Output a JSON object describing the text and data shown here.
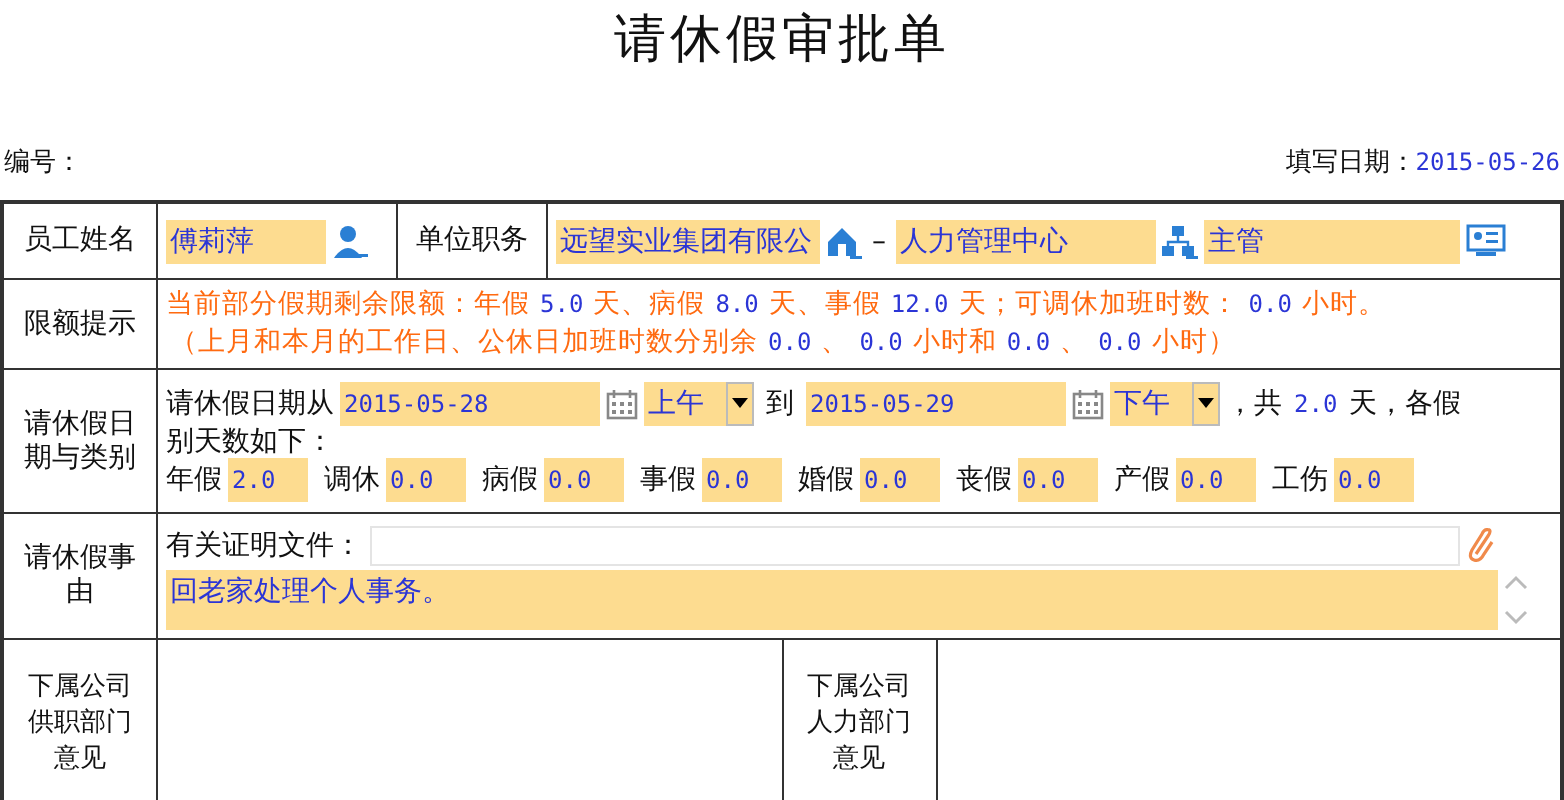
{
  "title": "请休假审批单",
  "header": {
    "number_label": "编号：",
    "date_label": "填写日期：",
    "date": "2015-05-26"
  },
  "employee": {
    "label": "员工姓名",
    "name": "傅莉萍",
    "position_label": "单位职务",
    "company": "远望实业集团有限公",
    "separator": "–",
    "department": "人力管理中心",
    "position": "主管"
  },
  "quota": {
    "label": "限额提示",
    "lines": [
      [
        {
          "kind": "text",
          "text": "当前部分假期剩余限额：年假"
        },
        {
          "kind": "value",
          "text": "5.0"
        },
        {
          "kind": "text",
          "text": "天、病假"
        },
        {
          "kind": "value",
          "text": "8.0"
        },
        {
          "kind": "text",
          "text": "天、事假"
        },
        {
          "kind": "value",
          "text": "12.0"
        },
        {
          "kind": "text",
          "text": "天；可调休加班时数："
        },
        {
          "kind": "value",
          "text": "0.0"
        },
        {
          "kind": "text",
          "text": "小时。"
        }
      ],
      [
        {
          "kind": "text",
          "text": "（上月和本月的工作日、公休日加班时数分别余"
        },
        {
          "kind": "value",
          "text": "0.0"
        },
        {
          "kind": "text",
          "text": "、"
        },
        {
          "kind": "value",
          "text": "0.0"
        },
        {
          "kind": "text",
          "text": "小时和"
        },
        {
          "kind": "value",
          "text": "0.0"
        },
        {
          "kind": "text",
          "text": "、"
        },
        {
          "kind": "value",
          "text": "0.0"
        },
        {
          "kind": "text",
          "text": "小时）"
        }
      ]
    ]
  },
  "period": {
    "label": "请休假日期与类别",
    "from_label": "请休假日期从",
    "from_date": "2015-05-28",
    "from_half": "上午",
    "to_label": "到",
    "to_date": "2015-05-29",
    "to_half": "下午",
    "total_label": "，共",
    "total": "2.0",
    "total_unit": "天，各假",
    "breakdown_label": "别天数如下：",
    "types": [
      {
        "name": "年假",
        "days": "2.0"
      },
      {
        "name": "调休",
        "days": "0.0"
      },
      {
        "name": "病假",
        "days": "0.0"
      },
      {
        "name": "事假",
        "days": "0.0"
      },
      {
        "name": "婚假",
        "days": "0.0"
      },
      {
        "name": "丧假",
        "days": "0.0"
      },
      {
        "name": "产假",
        "days": "0.0"
      },
      {
        "name": "工伤",
        "days": "0.0"
      }
    ]
  },
  "reason": {
    "label": "请休假事由",
    "attachment_label": "有关证明文件：",
    "text": "回老家处理个人事务。"
  },
  "opinions": [
    {
      "label": "下属公司供职部门意见"
    },
    {
      "label": "下属公司人力部门意见"
    }
  ]
}
